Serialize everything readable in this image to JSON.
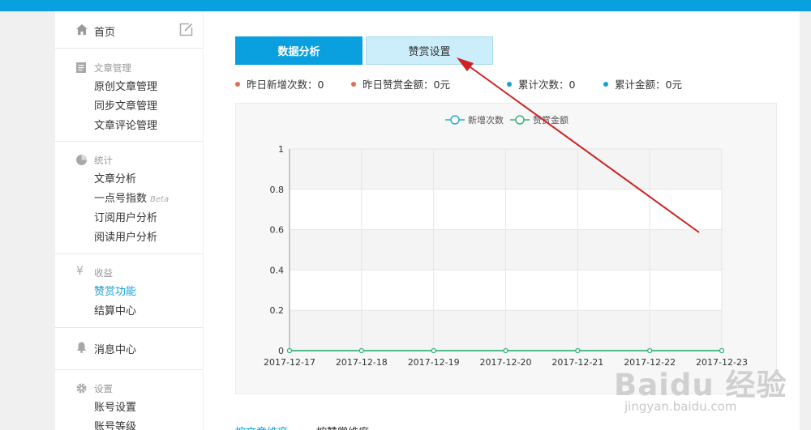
{
  "sidebar": {
    "home_label": "首页",
    "sections": [
      {
        "title": "文章管理",
        "items": [
          "原创文章管理",
          "同步文章管理",
          "文章评论管理"
        ]
      },
      {
        "title": "统计",
        "items": [
          "文章分析",
          "一点号指数",
          "订阅用户分析",
          "阅读用户分析"
        ],
        "beta_label": "Beta"
      },
      {
        "title": "收益",
        "items": [
          "赞赏功能",
          "结算中心"
        ],
        "active_item": "赞赏功能"
      },
      {
        "title": "消息中心"
      },
      {
        "title": "设置",
        "items": [
          "账号设置",
          "账号等级"
        ]
      }
    ]
  },
  "tabs": [
    {
      "label": "数据分析",
      "active": true
    },
    {
      "label": "赞赏设置",
      "active": false
    }
  ],
  "stats": [
    {
      "label": "昨日新增次数：0",
      "color": "#e06c5a"
    },
    {
      "label": "昨日赞赏金额：0元",
      "color": "#e06c5a"
    },
    {
      "label": "累计次数：0",
      "color": "#1a9fd9"
    },
    {
      "label": "累计金额：0元",
      "color": "#1a9fd9"
    }
  ],
  "chart_data": {
    "type": "line",
    "x": [
      "2017-12-17",
      "2017-12-18",
      "2017-12-19",
      "2017-12-20",
      "2017-12-21",
      "2017-12-22",
      "2017-12-23"
    ],
    "series": [
      {
        "name": "新增次数",
        "values": [
          0,
          0,
          0,
          0,
          0,
          0,
          0
        ],
        "color": "#2ab0c8"
      },
      {
        "name": "赞赏金额",
        "values": [
          0,
          0,
          0,
          0,
          0,
          0,
          0
        ],
        "color": "#3cb371"
      }
    ],
    "y_ticks": [
      "0",
      "0.2",
      "0.4",
      "0.6",
      "0.8",
      "1"
    ],
    "ylim": [
      0,
      1
    ],
    "grid": true,
    "legend_position": "top-center"
  },
  "bottom_tabs": [
    "按文章维度",
    "按赞赏维度"
  ],
  "watermark": {
    "logo": "Baidu 经验",
    "url": "jingyan.baidu.com"
  },
  "annotation": {
    "arrow_color": "#cc2222"
  }
}
